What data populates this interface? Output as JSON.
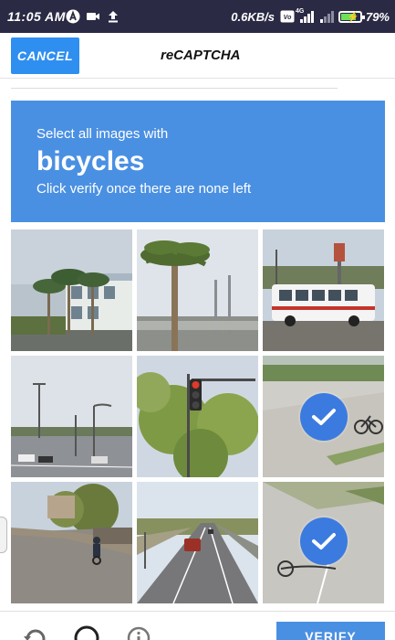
{
  "status_bar": {
    "time": "11:05 AM",
    "network_speed": "0.6KB/s",
    "network_type": "4G",
    "battery": "79%",
    "battery_level": 0.79,
    "icons": [
      "app-a-icon",
      "video-icon",
      "upload-icon",
      "vowifi-icon",
      "signal-icon",
      "signal-weak-icon",
      "battery-charging-icon"
    ]
  },
  "header": {
    "cancel_label": "CANCEL",
    "title": "reCAPTCHA"
  },
  "challenge": {
    "instruction": "Select all images with",
    "object": "bicycles",
    "subtext": "Click verify once there are none left",
    "accent_color": "#4a90e2"
  },
  "tiles": [
    {
      "index": 1,
      "scene": "building with palm trees",
      "selected": false
    },
    {
      "index": 2,
      "scene": "palm tree at harbor",
      "selected": false
    },
    {
      "index": 3,
      "scene": "white bus on street",
      "selected": false
    },
    {
      "index": 4,
      "scene": "road with street lamps",
      "selected": false
    },
    {
      "index": 5,
      "scene": "traffic light and trees",
      "selected": false
    },
    {
      "index": 6,
      "scene": "bicycle on sidewalk",
      "selected": true
    },
    {
      "index": 7,
      "scene": "cyclist on road",
      "selected": false
    },
    {
      "index": 8,
      "scene": "highway with car",
      "selected": false
    },
    {
      "index": 9,
      "scene": "bicycle on pavement",
      "selected": true
    }
  ],
  "footer": {
    "verify_label": "VERIFY",
    "icons": [
      "reload-icon",
      "audio-icon",
      "info-icon"
    ]
  }
}
